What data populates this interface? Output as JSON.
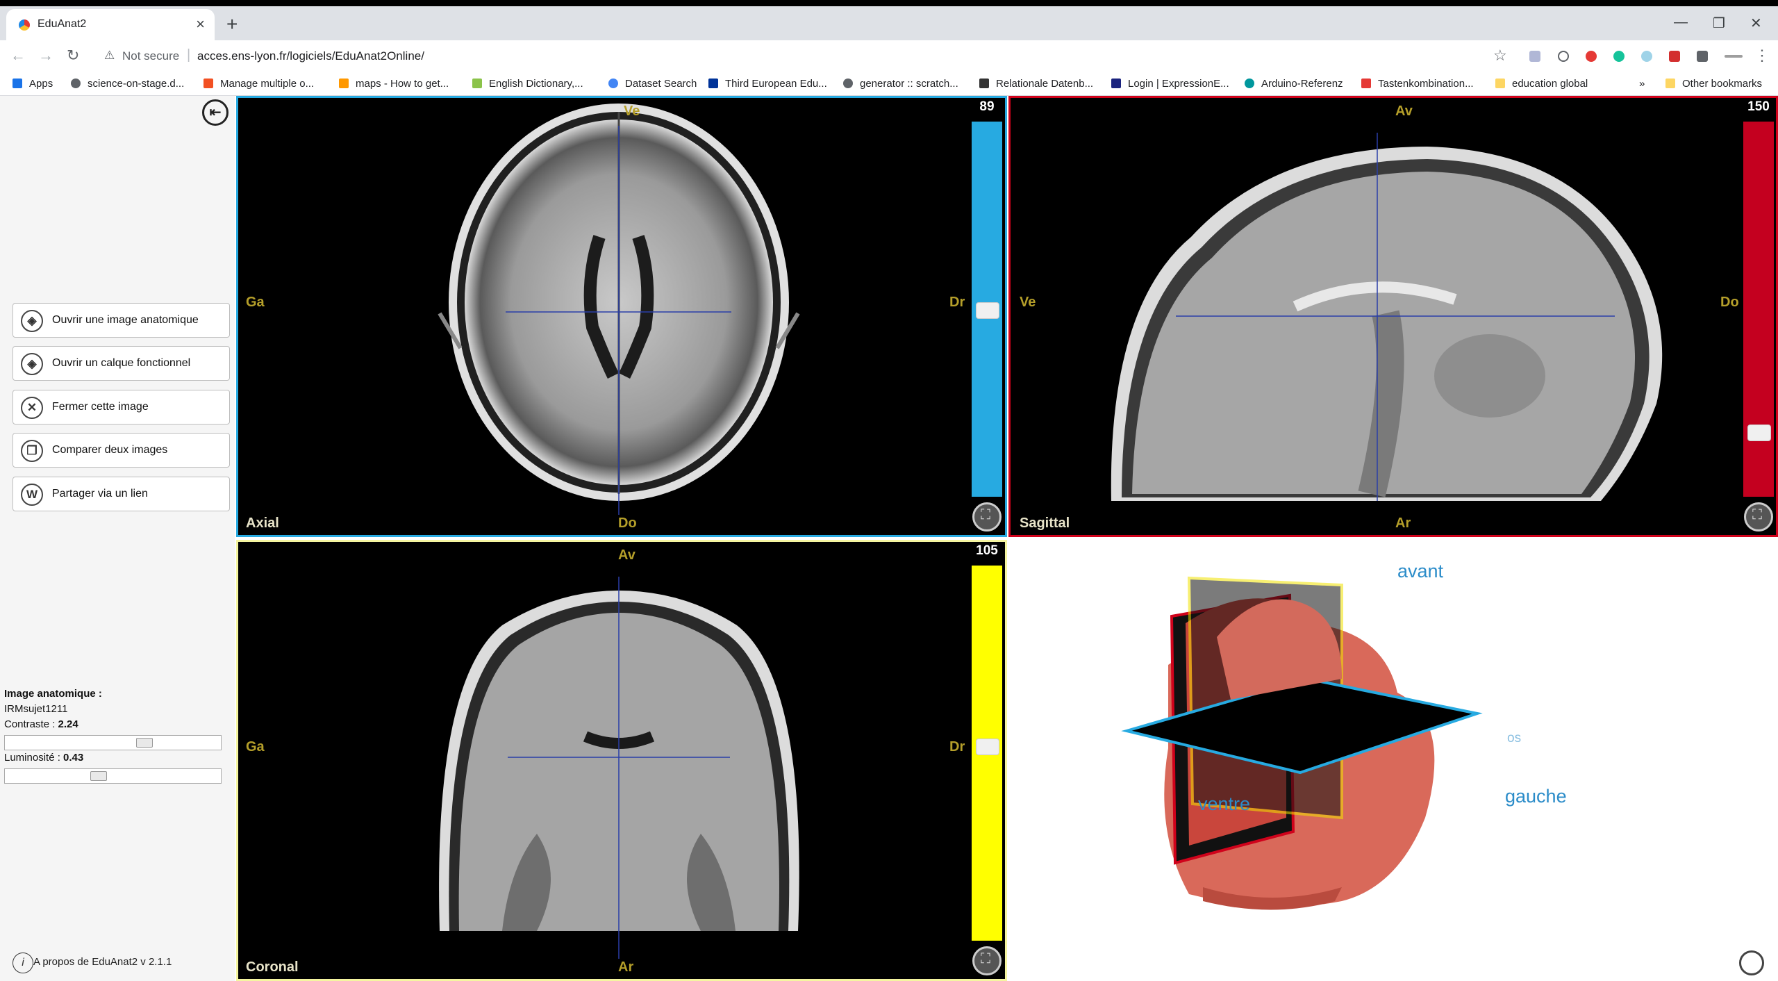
{
  "browser": {
    "tab_title": "EduAnat2",
    "url_security": "Not secure",
    "url": "acces.ens-lyon.fr/logiciels/EduAnat2Online/",
    "bookmarks": [
      {
        "label": "Apps",
        "color": "#1a73e8"
      },
      {
        "label": "science-on-stage.d...",
        "color": "#5f6368"
      },
      {
        "label": "Manage multiple o...",
        "color": "#f25022"
      },
      {
        "label": "maps - How to get...",
        "color": "#ff9800"
      },
      {
        "label": "English Dictionary,...",
        "color": "#8bc34a"
      },
      {
        "label": "Dataset Search",
        "color": "#4285f4"
      },
      {
        "label": "Third European Edu...",
        "color": "#003399"
      },
      {
        "label": "generator :: scratch...",
        "color": "#5f6368"
      },
      {
        "label": "Relationale Datenb...",
        "color": "#333333"
      },
      {
        "label": "Login | ExpressionE...",
        "color": "#1a237e"
      },
      {
        "label": "Arduino-Referenz",
        "color": "#00979d"
      },
      {
        "label": "Tastenkombination...",
        "color": "#e53935"
      },
      {
        "label": "education global",
        "color": "#fdd663"
      }
    ],
    "bookmarks_more": "»",
    "other_bookmarks": "Other bookmarks"
  },
  "sidebar": {
    "menu": [
      {
        "label": "Ouvrir une image anatomique",
        "icon": "◈"
      },
      {
        "label": "Ouvrir un calque fonctionnel",
        "icon": "◈"
      },
      {
        "label": "Fermer cette image",
        "icon": "✕"
      },
      {
        "label": "Comparer deux images",
        "icon": "❐"
      },
      {
        "label": "Partager via un lien",
        "icon": "W"
      }
    ],
    "image_heading": "Image anatomique :",
    "image_name": "IRMsujet1211",
    "contrast_label": "Contraste : ",
    "contrast_value": "2.24",
    "contrast_fraction": 0.66,
    "brightness_label": "Luminosité : ",
    "brightness_value": "0.43",
    "brightness_fraction": 0.43,
    "about": "A propos de EduAnat2 v 2.1.1"
  },
  "views": {
    "axial": {
      "name": "Axial",
      "top": "Ve",
      "bottom": "Do",
      "left": "Ga",
      "right": "Dr",
      "slice": "89",
      "color": "#27aae1"
    },
    "sagittal": {
      "name": "Sagittal",
      "top": "Av",
      "bottom": "Ar",
      "left": "Ve",
      "right": "Do",
      "slice": "150",
      "color": "#c4001f"
    },
    "coronal": {
      "name": "Coronal",
      "top": "Av",
      "bottom": "Ar",
      "left": "Ga",
      "right": "Dr",
      "slice": "105",
      "color": "#ffff00"
    }
  },
  "view3d": {
    "avant": "avant",
    "ventre": "ventre",
    "gauche": "gauche",
    "dos_partial": "os"
  }
}
